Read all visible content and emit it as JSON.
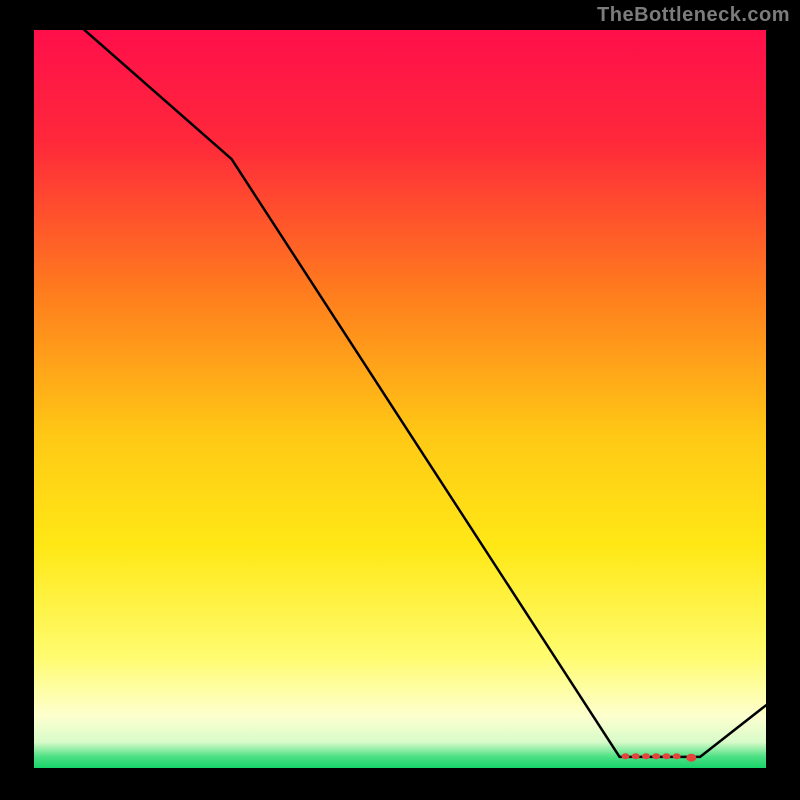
{
  "watermark": "TheBottleneck.com",
  "chart_data": {
    "type": "line",
    "title": "",
    "xlabel": "",
    "ylabel": "",
    "xlim": [
      0,
      1
    ],
    "ylim": [
      0,
      1
    ],
    "x": [
      0.0,
      0.27,
      0.8,
      0.91,
      1.0
    ],
    "values": [
      1.06,
      0.825,
      0.015,
      0.015,
      0.085
    ],
    "markers": {
      "x": [
        0.808,
        0.822,
        0.836,
        0.85,
        0.864,
        0.878,
        0.898
      ],
      "y": [
        0.016,
        0.016,
        0.016,
        0.016,
        0.016,
        0.016,
        0.014
      ]
    },
    "gradient_stops": [
      {
        "offset": 0.0,
        "color": "#ff0f4a"
      },
      {
        "offset": 0.15,
        "color": "#ff283b"
      },
      {
        "offset": 0.35,
        "color": "#ff7a1e"
      },
      {
        "offset": 0.55,
        "color": "#ffc915"
      },
      {
        "offset": 0.7,
        "color": "#ffe816"
      },
      {
        "offset": 0.85,
        "color": "#fffc70"
      },
      {
        "offset": 0.93,
        "color": "#fdffcf"
      },
      {
        "offset": 0.965,
        "color": "#d8fbc9"
      },
      {
        "offset": 0.985,
        "color": "#4be083"
      },
      {
        "offset": 1.0,
        "color": "#17d56b"
      }
    ]
  }
}
